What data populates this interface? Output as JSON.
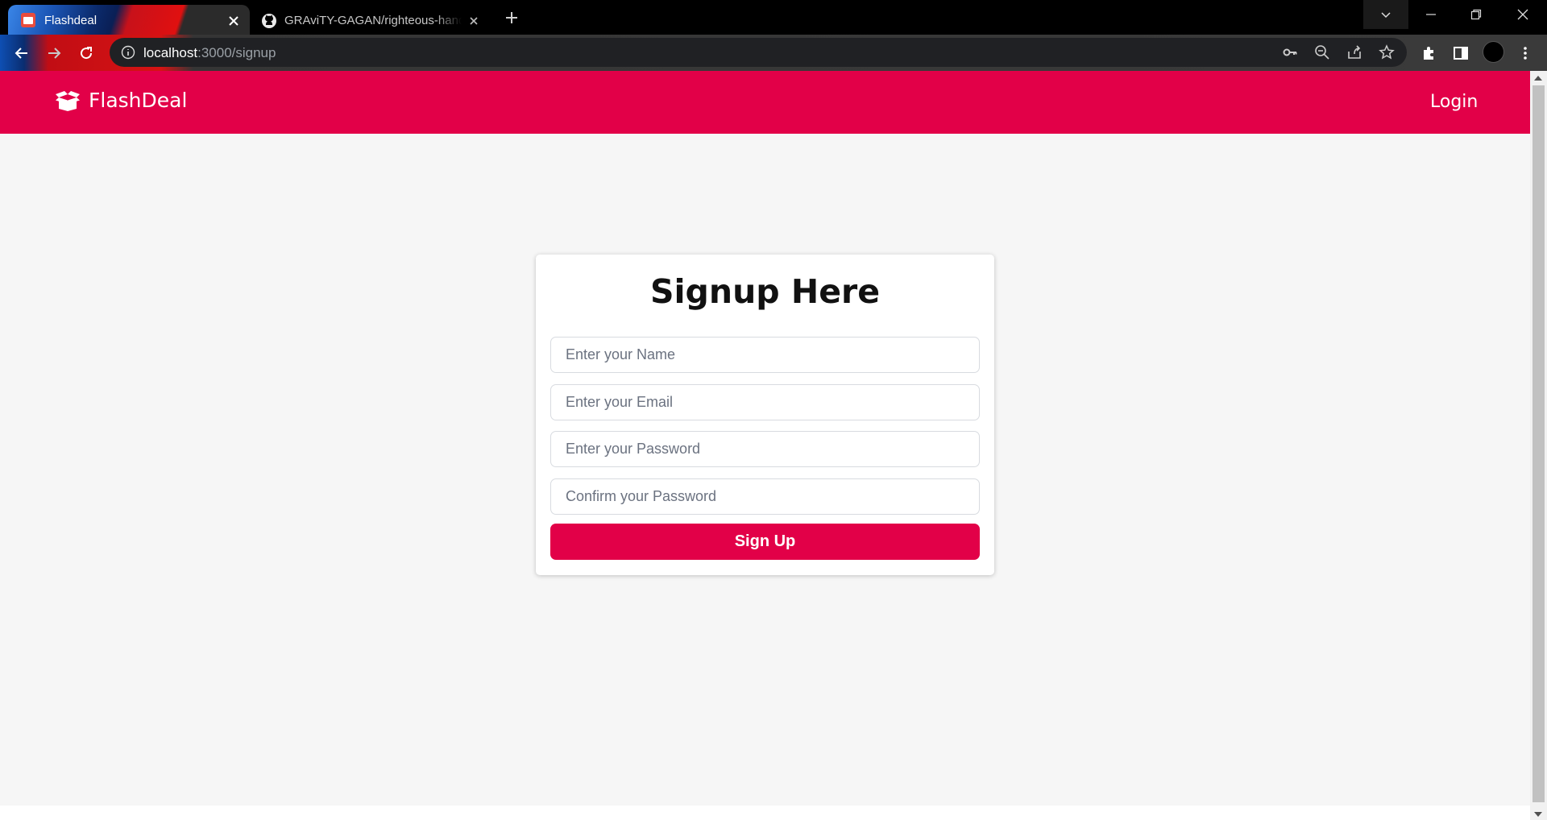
{
  "browser": {
    "tabs": [
      {
        "title": "Flashdeal",
        "favicon": "flashdeal-favicon",
        "active": true
      },
      {
        "title": "GRAviTY-GAGAN/righteous-hand",
        "favicon": "github-icon",
        "active": false
      }
    ],
    "url_host": "localhost",
    "url_path": ":3000/signup"
  },
  "navbar": {
    "brand": "FlashDeal",
    "brand_icon": "box-open-icon",
    "login_label": "Login",
    "color": "#e20048"
  },
  "form": {
    "title": "Signup Here",
    "name_placeholder": "Enter your Name",
    "email_placeholder": "Enter your Email",
    "password_placeholder": "Enter your Password",
    "confirm_placeholder": "Confirm your Password",
    "submit_label": "Sign Up"
  }
}
